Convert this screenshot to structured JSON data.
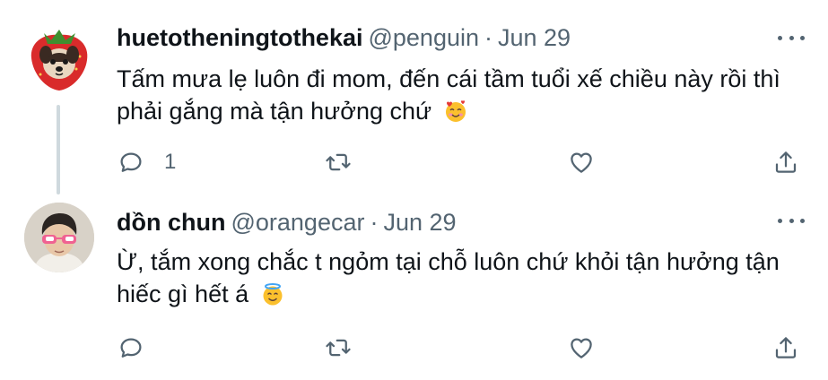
{
  "tweets": [
    {
      "name": "huetotheningtothekai",
      "handle": "@penguin",
      "separator": "·",
      "date": "Jun 29",
      "text_line1": "Tấm mưa lẹ luôn đi mom, đến cái tầm tuổi xế chiều này rồi thì",
      "text_line2": "phải gắng mà tận hưởng chứ",
      "emoji": "smiling-face-with-hearts",
      "reply_count": "1"
    },
    {
      "name": "dồn chun",
      "handle": "@orangecar",
      "separator": "·",
      "date": "Jun 29",
      "text_line1": "Ừ, tắm xong chắc t ngỏm tại chỗ luôn chứ khỏi tận hưởng tận",
      "text_line2": "hiếc gì hết á",
      "emoji": "smiling-face-with-halo"
    }
  ],
  "colors": {
    "text": "#0f1419",
    "secondary": "#536471",
    "thread_line": "#cfd9de"
  }
}
